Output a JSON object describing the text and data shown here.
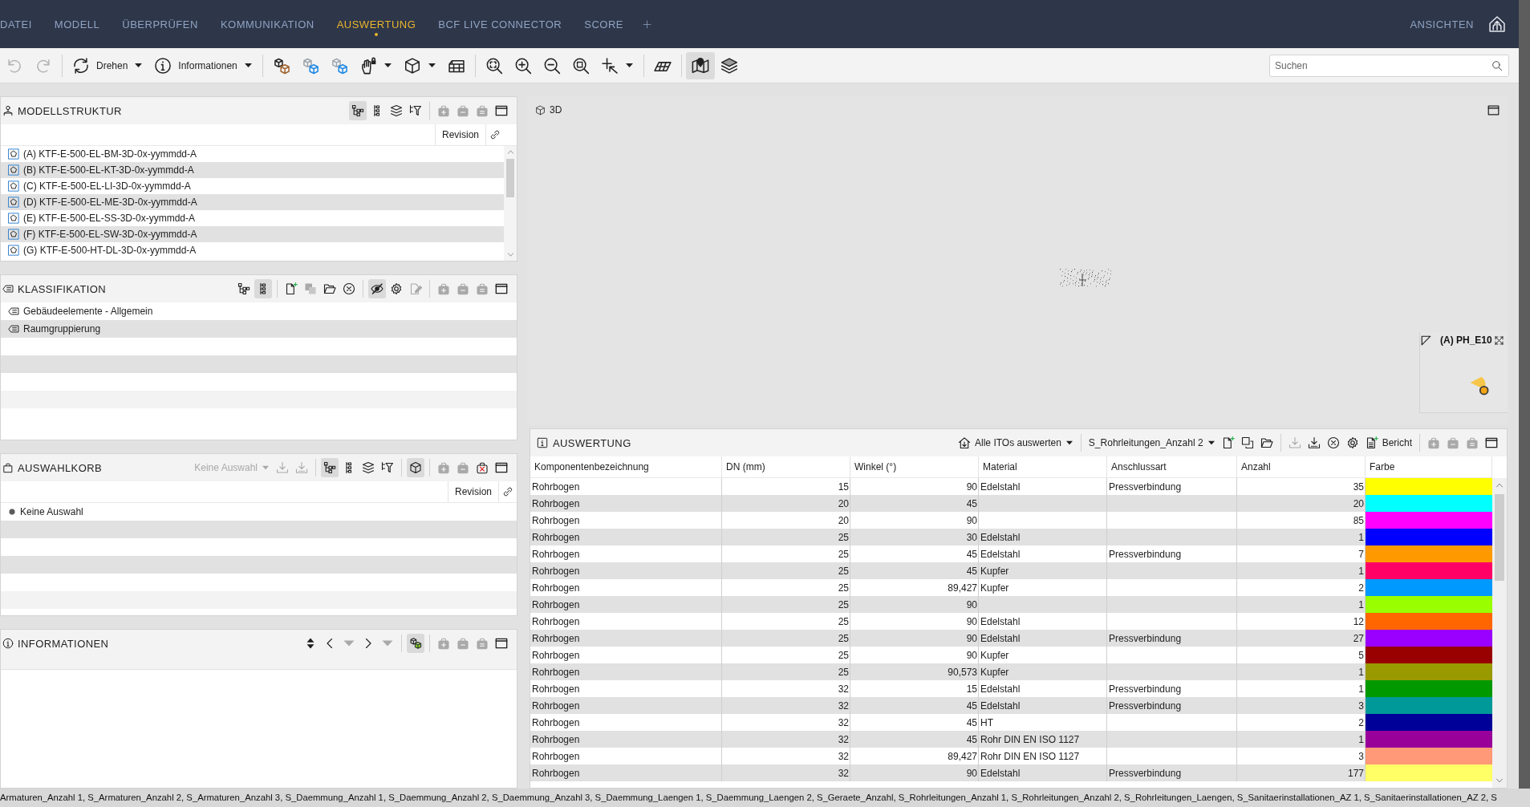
{
  "nav": {
    "items": [
      {
        "label": "DATEI",
        "selected": false
      },
      {
        "label": "MODELL",
        "selected": false
      },
      {
        "label": "ÜBERPRÜFEN",
        "selected": false
      },
      {
        "label": "KOMMUNIKATION",
        "selected": false
      },
      {
        "label": "AUSWERTUNG",
        "selected": true
      },
      {
        "label": "BCF LIVE CONNECTOR",
        "selected": false
      },
      {
        "label": "SCORE",
        "selected": false
      }
    ],
    "views": "ANSICHTEN"
  },
  "toolbar": {
    "groups": [
      [
        {
          "pressed": false,
          "disabled": true
        },
        {
          "pressed": false,
          "disabled": true
        }
      ],
      [
        {
          "label": "Drehen",
          "pressed": false,
          "disabled": false
        },
        {
          "label": "Informationen",
          "pressed": false,
          "disabled": false
        }
      ],
      [
        {
          "pressed": false,
          "disabled": false
        },
        {
          "pressed": false,
          "disabled": false
        },
        {
          "pressed": false,
          "disabled": false
        },
        {
          "pressed": false,
          "disabled": false
        },
        {
          "pressed": false,
          "disabled": false
        },
        {
          "pressed": false,
          "disabled": false
        }
      ],
      [
        {
          "pressed": false,
          "disabled": false
        },
        {
          "pressed": false,
          "disabled": false
        },
        {
          "pressed": false,
          "disabled": false
        },
        {
          "pressed": false,
          "disabled": false
        },
        {
          "pressed": false,
          "disabled": false
        }
      ],
      [
        {
          "pressed": false,
          "disabled": false
        }
      ],
      [
        {
          "pressed": true,
          "disabled": false
        },
        {
          "pressed": false,
          "disabled": false
        }
      ]
    ],
    "search": {
      "placeholder": "Suchen"
    }
  },
  "model_structure": {
    "title": "MODELLSTRUKTUR",
    "tools": [
      [
        {
          "pressed": true,
          "disabled": false
        },
        {
          "pressed": false,
          "disabled": false
        },
        {
          "pressed": false,
          "disabled": false
        },
        {
          "pressed": false,
          "disabled": false
        }
      ],
      [
        {
          "pressed": false,
          "disabled": true
        },
        {
          "pressed": false,
          "disabled": true
        },
        {
          "pressed": false,
          "disabled": true
        },
        {
          "pressed": false,
          "disabled": false
        }
      ]
    ],
    "columns": [
      "Revision"
    ],
    "items": [
      {
        "label": "(A) KTF-E-500-EL-BM-3D-0x-yymmdd-A"
      },
      {
        "label": "(B) KTF-E-500-EL-KT-3D-0x-yymmdd-A"
      },
      {
        "label": "(C) KTF-E-500-EL-LI-3D-0x-yymmdd-A"
      },
      {
        "label": "(D) KTF-E-500-EL-ME-3D-0x-yymmdd-A"
      },
      {
        "label": "(E) KTF-E-500-EL-SS-3D-0x-yymmdd-A"
      },
      {
        "label": "(F) KTF-E-500-EL-SW-3D-0x-yymmdd-A"
      },
      {
        "label": "(G) KTF-E-500-HT-DL-3D-0x-yymmdd-A"
      }
    ]
  },
  "classification": {
    "title": "KLASSIFIKATION",
    "tools": [
      [
        {
          "pressed": false,
          "disabled": false
        },
        {
          "pressed": true,
          "disabled": false
        }
      ],
      [
        {
          "pressed": false,
          "disabled": false
        },
        {
          "pressed": false,
          "disabled": true
        },
        {
          "pressed": false,
          "disabled": false
        },
        {
          "pressed": false,
          "disabled": false
        }
      ],
      [
        {
          "pressed": true,
          "disabled": false
        },
        {
          "pressed": false,
          "disabled": false
        },
        {
          "pressed": false,
          "disabled": true
        }
      ],
      [
        {
          "pressed": false,
          "disabled": true
        },
        {
          "pressed": false,
          "disabled": true
        },
        {
          "pressed": false,
          "disabled": true
        },
        {
          "pressed": false,
          "disabled": false
        }
      ]
    ],
    "items": [
      {
        "label": "Gebäudeelemente - Allgemein"
      },
      {
        "label": "Raumgruppierung"
      }
    ]
  },
  "selection_basket": {
    "title": "AUSWAHLKORB",
    "tools": [
      [
        {
          "label": "Keine Auswahl",
          "pressed": false,
          "disabled": true
        },
        {
          "pressed": false,
          "disabled": true
        },
        {
          "pressed": false,
          "disabled": true
        }
      ],
      [
        {
          "pressed": true,
          "disabled": false
        },
        {
          "pressed": false,
          "disabled": false
        },
        {
          "pressed": false,
          "disabled": false
        },
        {
          "pressed": false,
          "disabled": false
        }
      ],
      [
        {
          "pressed": true,
          "disabled": false
        }
      ],
      [
        {
          "pressed": false,
          "disabled": true
        },
        {
          "pressed": false,
          "disabled": true
        },
        {
          "pressed": false,
          "disabled": false
        },
        {
          "pressed": false,
          "disabled": false
        }
      ]
    ],
    "columns": [
      "Revision"
    ],
    "items": [
      {
        "label": "Keine Auswahl"
      }
    ]
  },
  "information": {
    "title": "INFORMATIONEN",
    "tools": [
      [
        {
          "pressed": false,
          "disabled": false
        },
        {
          "pressed": false,
          "disabled": false
        },
        {
          "pressed": false,
          "disabled": true
        },
        {
          "pressed": false,
          "disabled": false
        },
        {
          "pressed": false,
          "disabled": true
        }
      ],
      [
        {
          "pressed": true,
          "disabled": false
        }
      ],
      [
        {
          "pressed": false,
          "disabled": true
        },
        {
          "pressed": false,
          "disabled": true
        },
        {
          "pressed": false,
          "disabled": true
        },
        {
          "pressed": false,
          "disabled": false
        }
      ]
    ]
  },
  "viewer": {
    "title": "3D",
    "minimap": {
      "label": "(A) PH_E10"
    }
  },
  "report": {
    "title": "AUSWERTUNG",
    "tools": [
      [
        {
          "label": "Alle ITOs auswerten",
          "pressed": false,
          "disabled": false
        }
      ],
      [
        {
          "label": "S_Rohrleitungen_Anzahl 2",
          "pressed": false,
          "disabled": false
        },
        {
          "pressed": false,
          "disabled": false
        },
        {
          "pressed": false,
          "disabled": false
        },
        {
          "pressed": false,
          "disabled": false
        }
      ],
      [
        {
          "pressed": false,
          "disabled": true
        },
        {
          "pressed": false,
          "disabled": false
        },
        {
          "pressed": false,
          "disabled": false
        },
        {
          "pressed": false,
          "disabled": false
        },
        {
          "label": "Bericht",
          "pressed": false,
          "disabled": false
        }
      ],
      [
        {
          "pressed": false,
          "disabled": true
        },
        {
          "pressed": false,
          "disabled": true
        },
        {
          "pressed": false,
          "disabled": true
        },
        {
          "pressed": false,
          "disabled": false
        }
      ]
    ],
    "columns": [
      "Komponentenbezeichnung",
      "DN (mm)",
      "Winkel (°)",
      "Material",
      "Anschlussart",
      "Anzahl",
      "Farbe"
    ],
    "rows": [
      {
        "component": "Rohrbogen",
        "dn": "15",
        "angle": "90",
        "material": "Edelstahl",
        "connection": "Pressverbindung",
        "count": "35",
        "color": "#ffff00"
      },
      {
        "component": "Rohrbogen",
        "dn": "20",
        "angle": "45",
        "count": "20",
        "color": "#00ffff"
      },
      {
        "component": "Rohrbogen",
        "dn": "20",
        "angle": "90",
        "count": "85",
        "color": "#ff00ff"
      },
      {
        "component": "Rohrbogen",
        "dn": "25",
        "angle": "30",
        "material": "Edelstahl",
        "count": "1",
        "color": "#0000ff"
      },
      {
        "component": "Rohrbogen",
        "dn": "25",
        "angle": "45",
        "material": "Edelstahl",
        "connection": "Pressverbindung",
        "count": "7",
        "color": "#ff9900"
      },
      {
        "component": "Rohrbogen",
        "dn": "25",
        "angle": "45",
        "material": "Kupfer",
        "count": "1",
        "color": "#ff0066"
      },
      {
        "component": "Rohrbogen",
        "dn": "25",
        "angle": "89,427",
        "material": "Kupfer",
        "count": "2",
        "color": "#0099ff"
      },
      {
        "component": "Rohrbogen",
        "dn": "25",
        "angle": "90",
        "count": "1",
        "color": "#99ff00"
      },
      {
        "component": "Rohrbogen",
        "dn": "25",
        "angle": "90",
        "material": "Edelstahl",
        "count": "12",
        "color": "#ff6600"
      },
      {
        "component": "Rohrbogen",
        "dn": "25",
        "angle": "90",
        "material": "Edelstahl",
        "connection": "Pressverbindung",
        "count": "27",
        "color": "#9900ff"
      },
      {
        "component": "Rohrbogen",
        "dn": "25",
        "angle": "90",
        "material": "Kupfer",
        "count": "5",
        "color": "#990000"
      },
      {
        "component": "Rohrbogen",
        "dn": "25",
        "angle": "90,573",
        "material": "Kupfer",
        "count": "1",
        "color": "#999900"
      },
      {
        "component": "Rohrbogen",
        "dn": "32",
        "angle": "15",
        "material": "Edelstahl",
        "connection": "Pressverbindung",
        "count": "1",
        "color": "#009900"
      },
      {
        "component": "Rohrbogen",
        "dn": "32",
        "angle": "45",
        "material": "Edelstahl",
        "connection": "Pressverbindung",
        "count": "3",
        "color": "#009999"
      },
      {
        "component": "Rohrbogen",
        "dn": "32",
        "angle": "45",
        "material": "HT",
        "count": "2",
        "color": "#000099"
      },
      {
        "component": "Rohrbogen",
        "dn": "32",
        "angle": "45",
        "material": "Rohr DIN EN ISO 1127",
        "count": "1",
        "color": "#990099"
      },
      {
        "component": "Rohrbogen",
        "dn": "32",
        "angle": "89,427",
        "material": "Rohr DIN EN ISO 1127",
        "count": "3",
        "color": "#ff9977"
      },
      {
        "component": "Rohrbogen",
        "dn": "32",
        "angle": "90",
        "material": "Edelstahl",
        "connection": "Pressverbindung",
        "count": "177",
        "color": "#ffff66"
      }
    ]
  },
  "status_bar": {
    "text": "Armaturen_Anzahl 1, S_Armaturen_Anzahl 2, S_Armaturen_Anzahl 3, S_Daemmung_Anzahl 1, S_Daemmung_Anzahl 2, S_Daemmung_Anzahl 3, S_Daemmung_Laengen 1, S_Daemmung_Laengen 2, S_Geraete_Anzahl, S_Rohrleitungen_Anzahl 1, S_Rohrleitungen_Anzahl 2, S_Rohrleitungen_Laengen, S_Sanitaerinstallationen_AZ 1, S_Sanitaerinstallationen_AZ 2, S"
  }
}
